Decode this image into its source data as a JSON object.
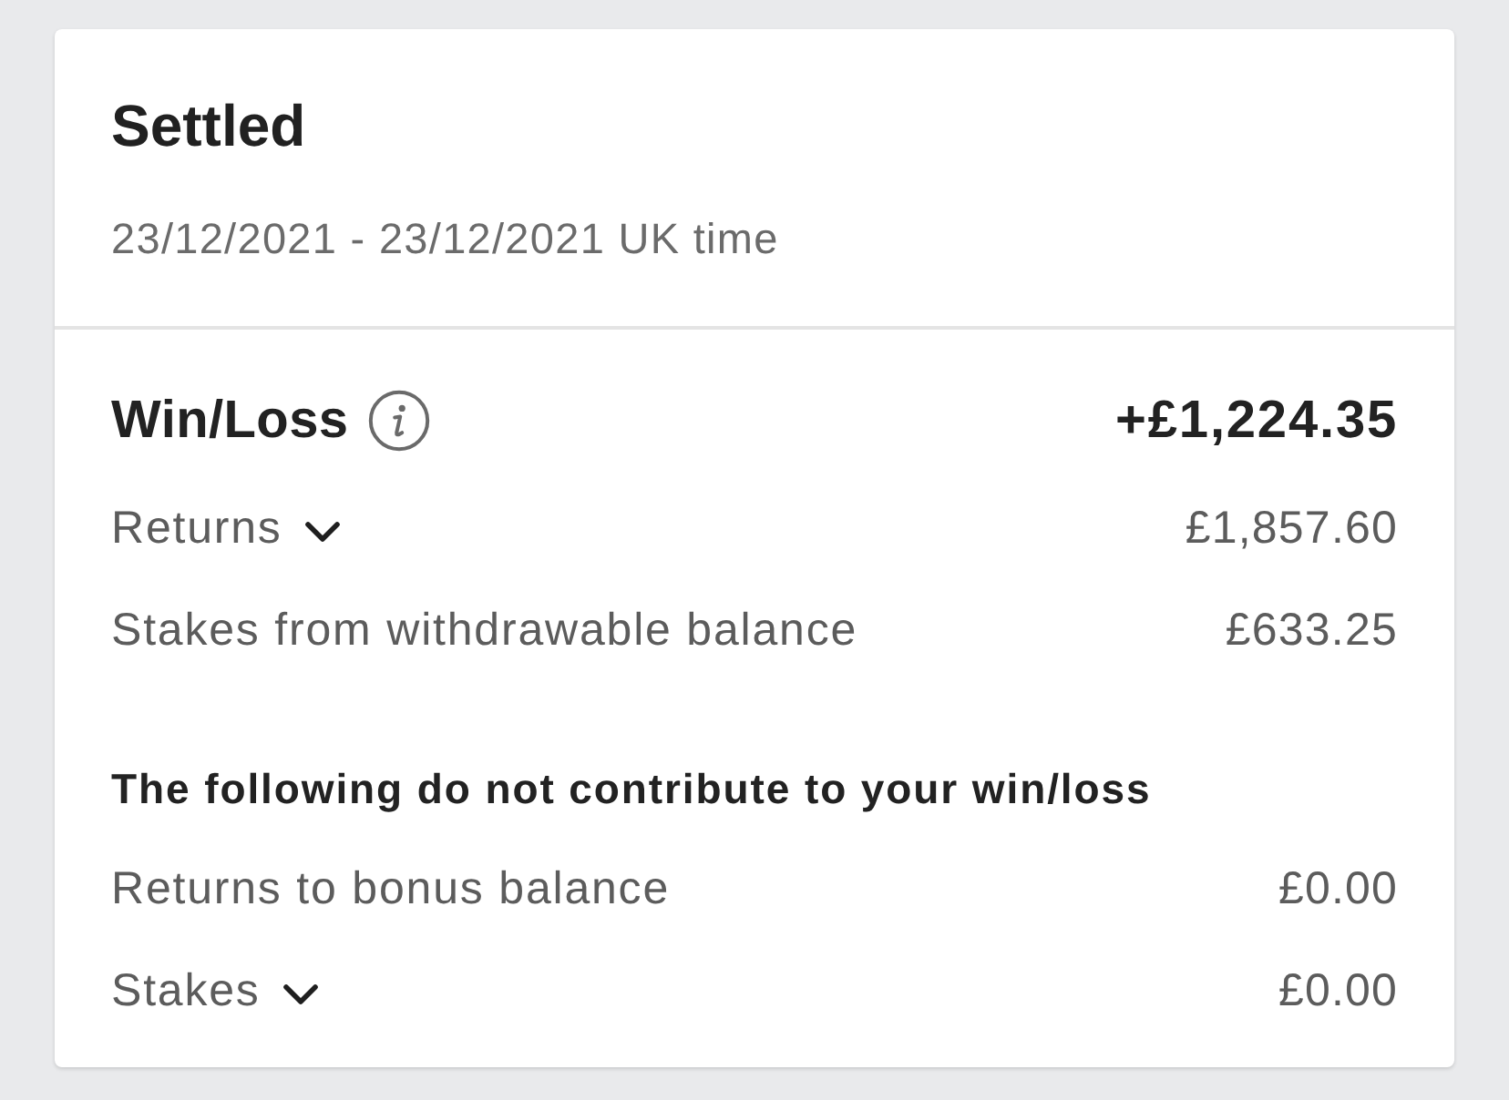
{
  "header": {
    "title": "Settled",
    "date_range": "23/12/2021 - 23/12/2021 UK time"
  },
  "win_loss": {
    "label": "Win/Loss",
    "value": "+£1,224.35"
  },
  "rows": [
    {
      "kind": "expandable",
      "label": "Returns",
      "expanded": false,
      "value": "£1,857.60"
    },
    {
      "kind": "plain",
      "label": "Stakes from withdrawable balance",
      "value": "£633.25"
    }
  ],
  "excluded": {
    "heading": "The following do not contribute to your win/loss",
    "rows": [
      {
        "kind": "plain",
        "label": "Returns to bonus balance",
        "value": "£0.00"
      },
      {
        "kind": "expandable",
        "label": "Stakes",
        "expanded": false,
        "value": "£0.00"
      }
    ]
  }
}
